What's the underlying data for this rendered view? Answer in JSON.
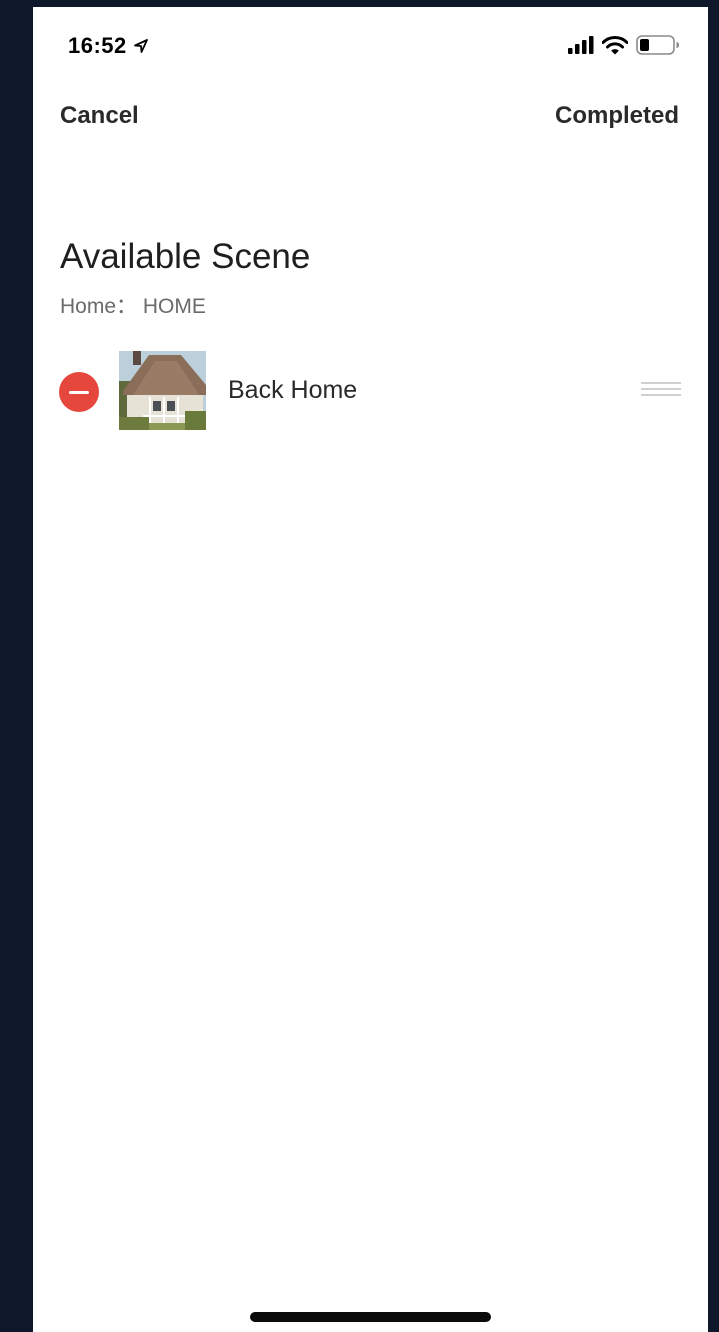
{
  "status_bar": {
    "time": "16:52",
    "icons": [
      "location-arrow-icon",
      "signal-icon",
      "wifi-icon",
      "battery-icon"
    ]
  },
  "nav": {
    "cancel_label": "Cancel",
    "completed_label": "Completed"
  },
  "page": {
    "title": "Available Scene",
    "subtitle": "Home： HOME"
  },
  "scenes": [
    {
      "name": "Back Home",
      "thumbnail": "house-photo",
      "delete_icon": "minus-circle-icon",
      "drag_icon": "drag-handle-icon"
    }
  ],
  "colors": {
    "background": "#0f182a",
    "screen": "#ffffff",
    "delete_red": "#e5473c",
    "text_primary": "#2a2a2a",
    "text_secondary": "#6b6b6b",
    "drag_handle": "#cfcfcf"
  }
}
